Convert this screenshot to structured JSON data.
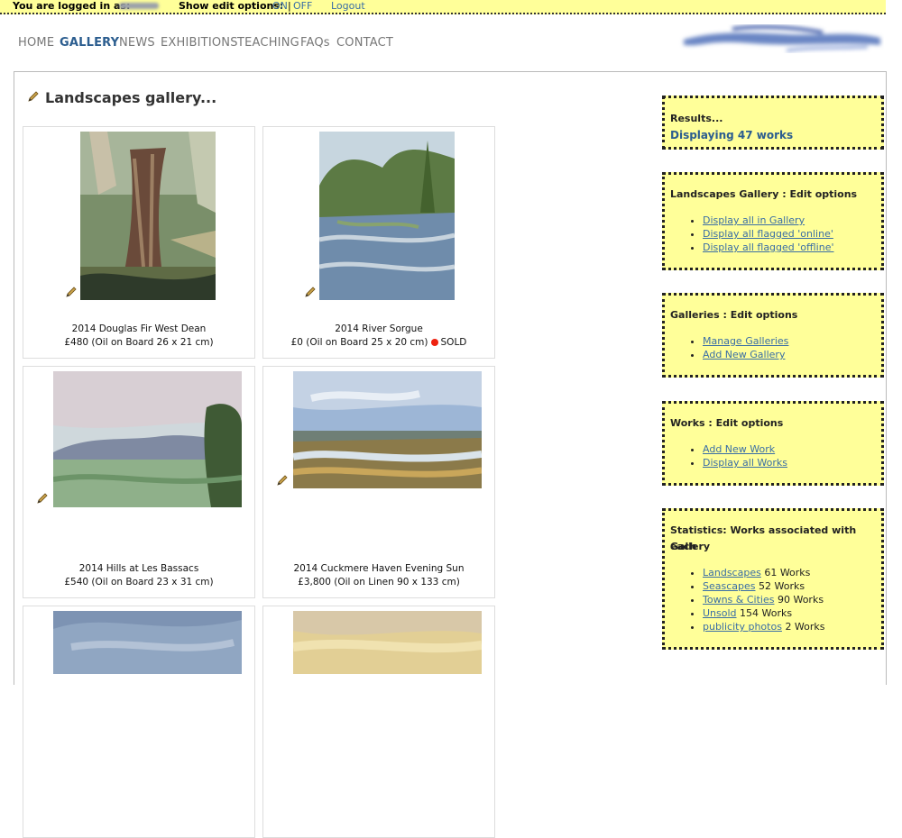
{
  "topbar": {
    "logged_label": "You are logged in as:",
    "edit_label": "Show edit options:",
    "on": "ON",
    "sep": "|",
    "off": "OFF",
    "logout": "Logout"
  },
  "nav": {
    "items": [
      "HOME",
      "GALLERY",
      "NEWS",
      "EXHIBITIONS",
      "TEACHING",
      "FAQs",
      "CONTACT"
    ],
    "active": "GALLERY"
  },
  "page": {
    "title": "Landscapes gallery..."
  },
  "works": [
    {
      "title": "2014 Douglas Fir West Dean",
      "details": "£480 (Oil on Board 26 x 21 cm)"
    },
    {
      "title": "2014 River Sorgue",
      "details": "£0 (Oil on Board 25 x 20 cm)",
      "sold": "SOLD"
    },
    {
      "title": "2014 Hills at Les Bassacs",
      "details": "£540 (Oil on Board 23 x 31 cm)"
    },
    {
      "title": "2014 Cuckmere Haven Evening Sun",
      "details": "£3,800 (Oil on Linen 90 x 133 cm)"
    }
  ],
  "sidebar": {
    "results": {
      "heading": "Results...",
      "value": "Displaying 47 works"
    },
    "gallery_edit": {
      "heading": "Landscapes Gallery : Edit options",
      "links": [
        "Display all in Gallery",
        "Display all flagged 'online'",
        "Display all flagged 'offline'"
      ]
    },
    "galleries_edit": {
      "heading": "Galleries : Edit options",
      "links": [
        "Manage Galleries",
        "Add New Gallery"
      ]
    },
    "works_edit": {
      "heading": "Works : Edit options",
      "links": [
        "Add New Work",
        "Display all Works"
      ]
    },
    "stats": {
      "heading_line1": "Statistics: Works associated with each",
      "heading_line2": "Gallery",
      "items": [
        {
          "name": "Landscapes",
          "count": "61 Works"
        },
        {
          "name": "Seascapes",
          "count": "52 Works"
        },
        {
          "name": "Towns & Cities",
          "count": "90 Works"
        },
        {
          "name": "Unsold",
          "count": "154 Works"
        },
        {
          "name": "publicity photos",
          "count": "2 Works"
        }
      ]
    }
  },
  "colors": {
    "accent": "#2b5d8f",
    "link": "#3a6ea5",
    "highlight": "#ffff99",
    "sold_dot": "#e22211"
  }
}
